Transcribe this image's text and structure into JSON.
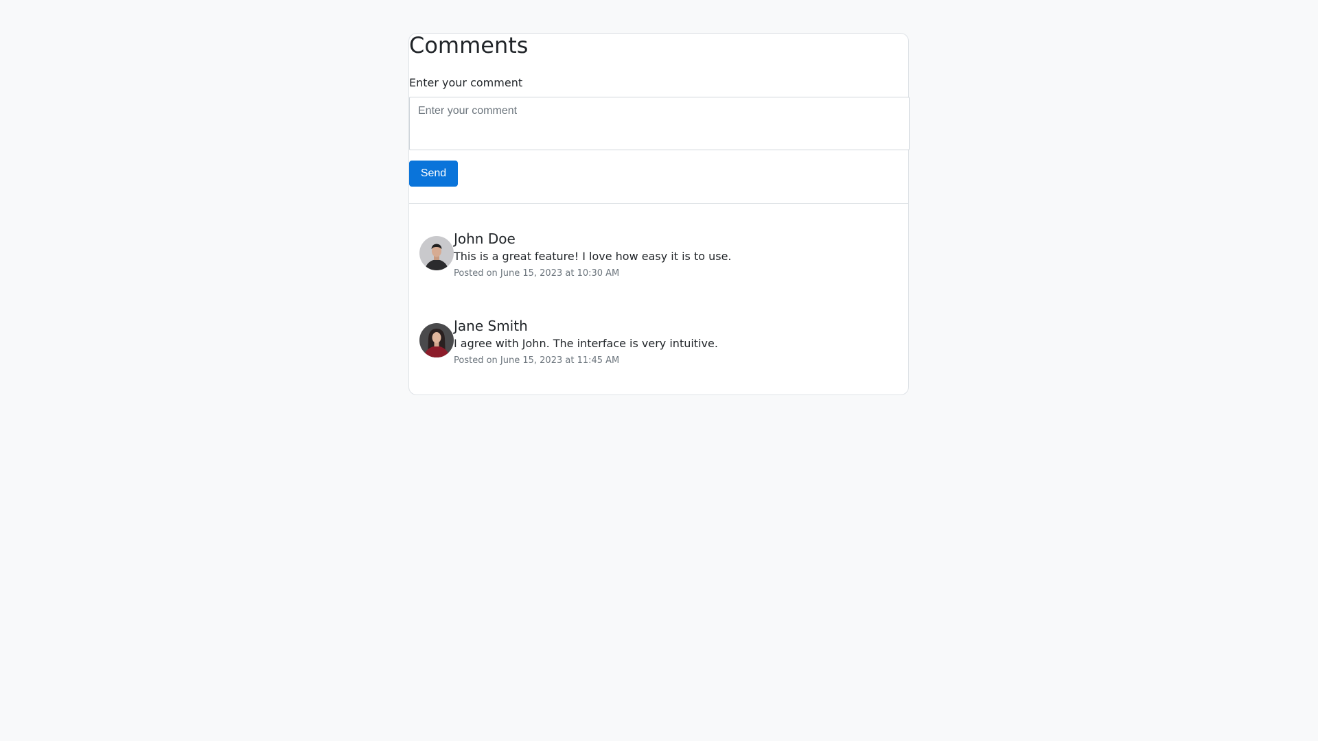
{
  "comments_section": {
    "title": "Comments",
    "input_label": "Enter your comment",
    "input_placeholder": "Enter your comment",
    "input_value": "",
    "send_label": "Send"
  },
  "comments": [
    {
      "author": "John Doe",
      "avatar_icon": "user-avatar-icon",
      "text": "This is a great feature! I love how easy it is to use.",
      "posted": "Posted on June 15, 2023 at 10:30 AM"
    },
    {
      "author": "Jane Smith",
      "avatar_icon": "user-avatar-icon",
      "text": "I agree with John. The interface is very intuitive.",
      "posted": "Posted on June 15, 2023 at 11:45 AM"
    }
  ],
  "colors": {
    "accent": "#0a74da",
    "page_background": "#f8f9fa",
    "muted_text": "#6c757d"
  }
}
